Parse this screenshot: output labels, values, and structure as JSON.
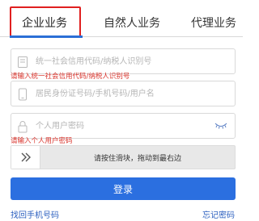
{
  "tabs": [
    {
      "label": "企业业务",
      "active": true
    },
    {
      "label": "自然人业务",
      "active": false
    },
    {
      "label": "代理业务",
      "active": false
    }
  ],
  "form": {
    "credit_code": {
      "placeholder": "统一社会信用代码/纳税人识别号",
      "value": "",
      "icon": "building-icon"
    },
    "credit_code_error": "请输入统一社会信用代码/纳税人识别号",
    "account": {
      "placeholder": "居民身份证号码/手机号码/用户名",
      "value": "",
      "icon": "phone-icon"
    },
    "password": {
      "placeholder": "个人用户密码",
      "value": "",
      "icon": "lock-icon"
    },
    "password_error": "请输入个人用户密码"
  },
  "slider": {
    "text": "请按住滑块，拖动到最右边",
    "progress": 0
  },
  "login_button": "登录",
  "links": {
    "find_phone": "找回手机号码",
    "forgot_password": "忘记密码"
  },
  "colors": {
    "accent": "#2b6fe0",
    "error": "#d9332b",
    "highlight": "#e02020"
  }
}
